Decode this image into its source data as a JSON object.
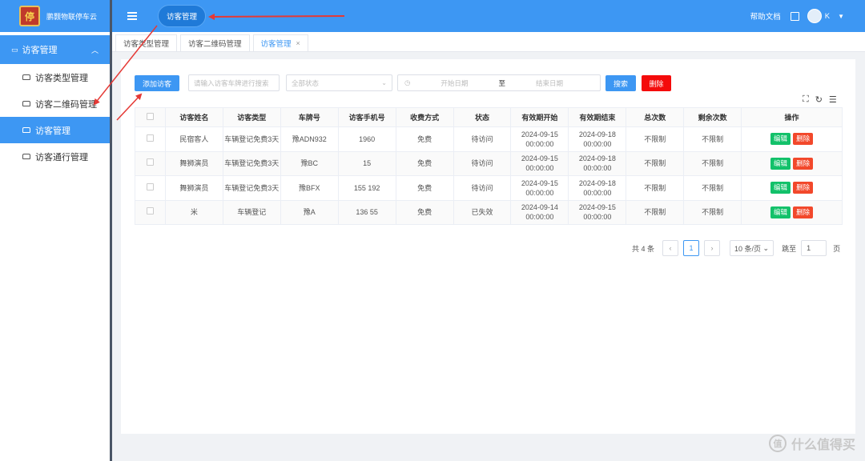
{
  "app": {
    "name": "鹏颢物联停车云"
  },
  "topbar": {
    "active_label": "访客管理",
    "help": "帮助文档",
    "username": "K"
  },
  "sidebar": {
    "group_label": "访客管理",
    "items": [
      {
        "label": "访客类型管理"
      },
      {
        "label": "访客二维码管理"
      },
      {
        "label": "访客管理"
      },
      {
        "label": "访客通行管理"
      }
    ]
  },
  "tabs": [
    {
      "label": "访客类型管理"
    },
    {
      "label": "访客二维码管理"
    },
    {
      "label": "访客管理"
    }
  ],
  "toolbar": {
    "add_label": "添加访客",
    "plate_placeholder": "请输入访客车牌进行搜索",
    "status_placeholder": "全部状态",
    "start_placeholder": "开始日期",
    "date_sep": "至",
    "end_placeholder": "结束日期",
    "search_label": "搜索",
    "delete_label": "删除"
  },
  "table": {
    "headers": [
      "访客姓名",
      "访客类型",
      "车牌号",
      "访客手机号",
      "收费方式",
      "状态",
      "有效期开始",
      "有效期结束",
      "总次数",
      "剩余次数",
      "操作"
    ],
    "rows": [
      {
        "name": "民宿客人",
        "type": "车辆登记免费3天",
        "plate": "豫ADN932",
        "phone": "1960",
        "fee": "免费",
        "status": "待访问",
        "start_date": "2024-09-15",
        "start_time": "00:00:00",
        "end_date": "2024-09-18",
        "end_time": "00:00:00",
        "total": "不限制",
        "remain": "不限制"
      },
      {
        "name": "舞狮演员",
        "type": "车辆登记免费3天",
        "plate": "豫BC",
        "phone": "15",
        "fee": "免费",
        "status": "待访问",
        "start_date": "2024-09-15",
        "start_time": "00:00:00",
        "end_date": "2024-09-18",
        "end_time": "00:00:00",
        "total": "不限制",
        "remain": "不限制"
      },
      {
        "name": "舞狮演员",
        "type": "车辆登记免费3天",
        "plate": "豫BFX",
        "phone": "155 192",
        "fee": "免费",
        "status": "待访问",
        "start_date": "2024-09-15",
        "start_time": "00:00:00",
        "end_date": "2024-09-18",
        "end_time": "00:00:00",
        "total": "不限制",
        "remain": "不限制"
      },
      {
        "name": "米",
        "type": "车辆登记",
        "plate": "豫A",
        "phone": "136 55",
        "fee": "免费",
        "status": "已失效",
        "start_date": "2024-09-14",
        "start_time": "00:00:00",
        "end_date": "2024-09-15",
        "end_time": "00:00:00",
        "total": "不限制",
        "remain": "不限制"
      }
    ],
    "edit_label": "编辑",
    "delete_label": "删除"
  },
  "pagination": {
    "total_text": "共 4 条",
    "current_page": "1",
    "page_size": "10 条/页",
    "jump_label": "跳至",
    "jump_value": "1",
    "page_unit": "页"
  },
  "watermark": {
    "text": "什么值得买",
    "mark": "值"
  },
  "colors": {
    "primary": "#3d97f3",
    "danger": "#f40b0b",
    "success": "#13c16a",
    "annotation": "#e53935"
  }
}
